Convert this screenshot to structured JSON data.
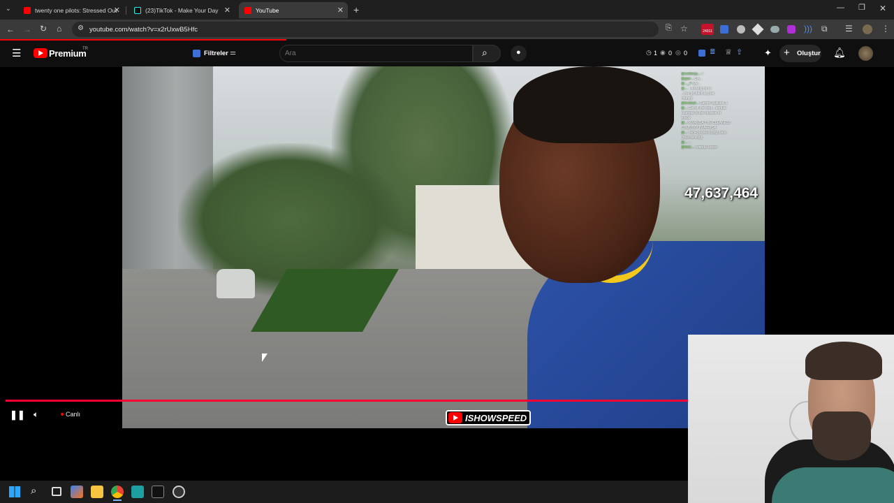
{
  "browser": {
    "tabs": [
      {
        "title": "twenty one pilots: Stressed Out",
        "favicon": "youtube-favicon",
        "active": false
      },
      {
        "title": "(23)TikTok - Make Your Day",
        "favicon": "tiktok-favicon",
        "active": false
      },
      {
        "title": "YouTube",
        "favicon": "youtube-favicon",
        "active": true
      }
    ],
    "new_tab": "+",
    "url": "youtube.com/watch?v=x2rUxwB5Hfc",
    "extension_badge": "24011"
  },
  "youtube": {
    "logo": "Premium",
    "logo_region": "TR",
    "filter_label": "Filtreler",
    "search_placeholder": "Ara",
    "header_stats": [
      "1",
      "0",
      "0"
    ],
    "create_label": "Oluştur"
  },
  "video": {
    "chat": [
      {
        "user": "@soldierja...",
        "msg": "!!"
      },
      {
        "user": "@garr...",
        "msg": "CA..."
      },
      {
        "user": "@..._7",
        "msg": "We..."
      },
      {
        "user": "@...",
        "msg": "...looking for in"
      },
      {
        "user": "",
        "msg": "...you go back to your"
      },
      {
        "user": "",
        "msg": "country"
      },
      {
        "user": "@football...",
        "msg": "Darren Watkins Jr"
      },
      {
        "user": "@...",
        "msg": "Get off the roof... terrible"
      },
      {
        "user": "",
        "msg": "example to the children in"
      },
      {
        "user": "",
        "msg": "Africa"
      },
      {
        "user": "@...",
        "msg": "RWANDA THE CLEANEST"
      },
      {
        "user": "",
        "msg": "COUNTRY IN AFRICA"
      },
      {
        "user": "@...",
        "msg": ":face-purple-crying::face-"
      },
      {
        "user": "",
        "msg": "green-smiling:"
      },
      {
        "user": "@...",
        "msg": "..."
      },
      {
        "user": "@KAZ...",
        "msg": "rwanda soooo"
      }
    ],
    "counter": "47,637,464",
    "channel_tag": "ISHOWSPEED",
    "live_label": "Canlı",
    "progress": 1.0
  },
  "colors": {
    "accent_red": "#ff0000",
    "progress_red": "#ff0033",
    "header_bg": "#0f0f0f"
  }
}
